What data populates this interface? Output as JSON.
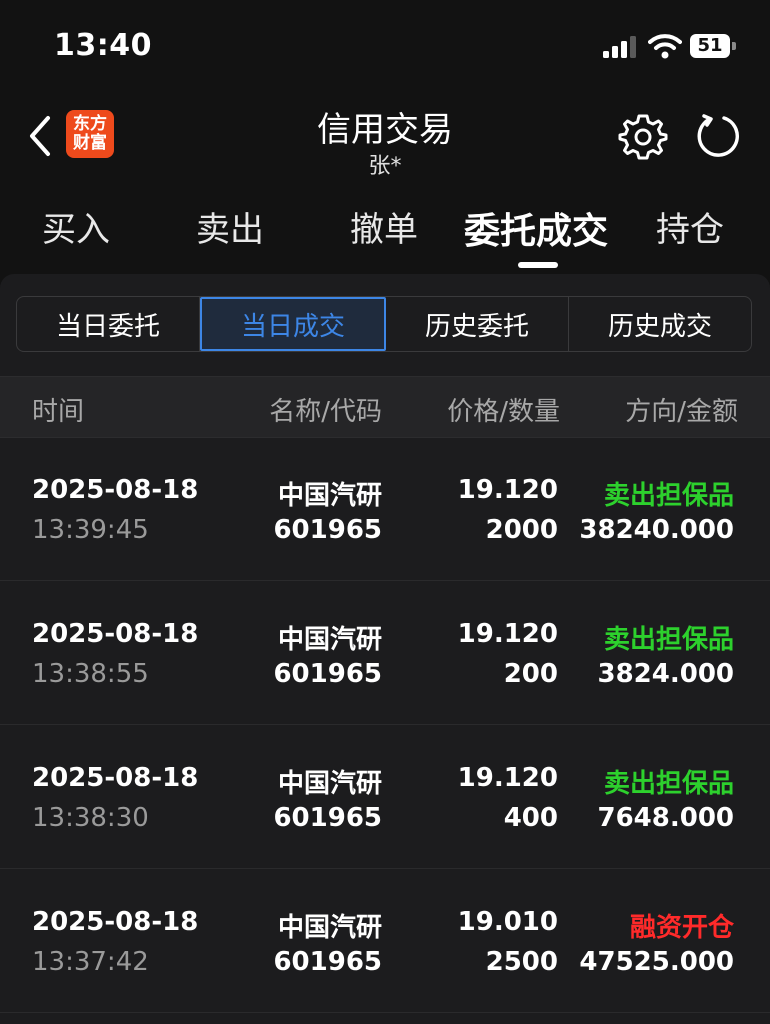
{
  "status": {
    "time": "13:40",
    "battery": "51"
  },
  "header": {
    "title": "信用交易",
    "subtitle": "张*",
    "logo_line1": "东方",
    "logo_line2": "财富"
  },
  "tabs": [
    "买入",
    "卖出",
    "撤单",
    "委托成交",
    "持仓"
  ],
  "active_tab": "委托成交",
  "segments": [
    "当日委托",
    "当日成交",
    "历史委托",
    "历史成交"
  ],
  "active_segment": "当日成交",
  "columns": {
    "time": "时间",
    "name_code": "名称/代码",
    "price_qty": "价格/数量",
    "dir_amount": "方向/金额"
  },
  "colors": {
    "sell": "#2dd12d",
    "buy": "#ff2a2a",
    "accent": "#3d86e6",
    "logo": "#ee4a1c"
  },
  "rows": [
    {
      "date": "2025-08-18",
      "time": "13:39:45",
      "name": "中国汽研",
      "code": "601965",
      "price": "19.120",
      "qty": "2000",
      "direction": "卖出担保品",
      "dir_type": "sell",
      "amount": "38240.000"
    },
    {
      "date": "2025-08-18",
      "time": "13:38:55",
      "name": "中国汽研",
      "code": "601965",
      "price": "19.120",
      "qty": "200",
      "direction": "卖出担保品",
      "dir_type": "sell",
      "amount": "3824.000"
    },
    {
      "date": "2025-08-18",
      "time": "13:38:30",
      "name": "中国汽研",
      "code": "601965",
      "price": "19.120",
      "qty": "400",
      "direction": "卖出担保品",
      "dir_type": "sell",
      "amount": "7648.000"
    },
    {
      "date": "2025-08-18",
      "time": "13:37:42",
      "name": "中国汽研",
      "code": "601965",
      "price": "19.010",
      "qty": "2500",
      "direction": "融资开仓",
      "dir_type": "buy",
      "amount": "47525.000"
    }
  ]
}
